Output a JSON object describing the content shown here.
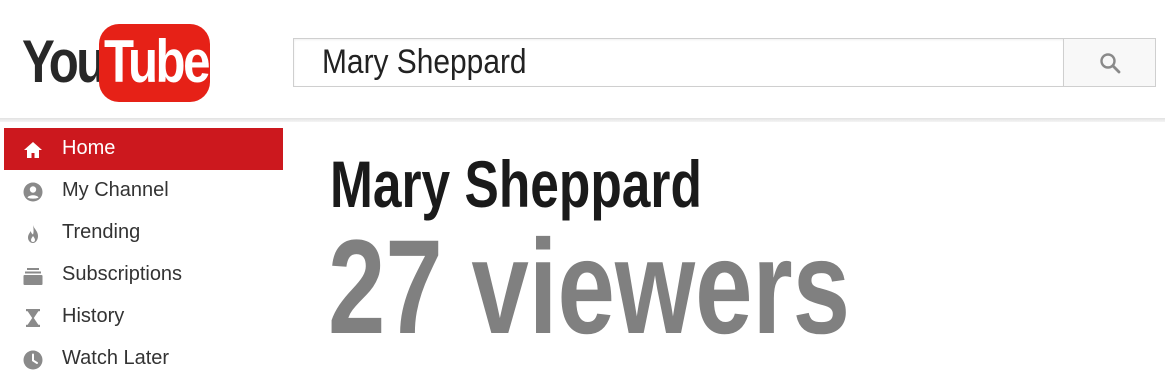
{
  "logo": {
    "you": "You",
    "tube": "Tube"
  },
  "search": {
    "value": "Mary Sheppard",
    "button_icon": "search-icon"
  },
  "sidebar": {
    "items": [
      {
        "label": "Home",
        "icon": "home-icon",
        "active": true
      },
      {
        "label": "My Channel",
        "icon": "account-icon",
        "active": false
      },
      {
        "label": "Trending",
        "icon": "flame-icon",
        "active": false
      },
      {
        "label": "Subscriptions",
        "icon": "subscriptions-icon",
        "active": false
      },
      {
        "label": "History",
        "icon": "hourglass-icon",
        "active": false
      },
      {
        "label": "Watch Later",
        "icon": "clock-icon",
        "active": false
      }
    ]
  },
  "main": {
    "channel_name": "Mary Sheppard",
    "viewers": "27 viewers"
  },
  "colors": {
    "brand_red": "#e62117",
    "active_nav": "#cc181e",
    "viewers_gray": "#808080",
    "icon_gray": "#8a8a8a"
  }
}
